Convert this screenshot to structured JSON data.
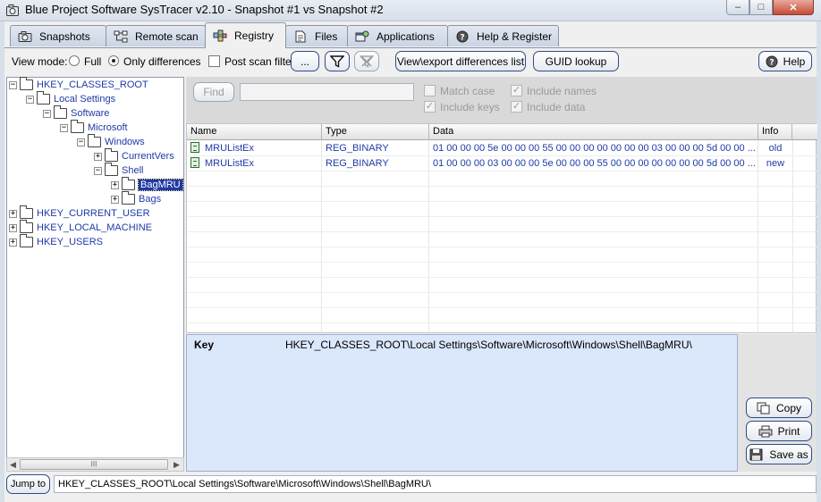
{
  "window": {
    "title": "Blue Project Software SysTracer v2.10 - Snapshot #1 vs Snapshot #2",
    "minimize": "–",
    "maximize": "□",
    "close": "✕"
  },
  "tabs": [
    {
      "label": "Snapshots",
      "icon": "camera-icon"
    },
    {
      "label": "Remote scan",
      "icon": "network-icon"
    },
    {
      "label": "Registry",
      "icon": "registry-icon",
      "active": true
    },
    {
      "label": "Files",
      "icon": "file-icon"
    },
    {
      "label": "Applications",
      "icon": "applications-icon"
    },
    {
      "label": "Help & Register",
      "icon": "help-icon"
    }
  ],
  "toolbar": {
    "view_mode_label": "View mode:",
    "full_label": "Full",
    "only_differences_label": "Only differences",
    "selected_view_mode": "Only differences",
    "post_scan_filter_label": "Post scan filter",
    "ellipsis_label": "...",
    "export_label": "View\\export differences list",
    "guid_label": "GUID lookup",
    "help_label": "Help"
  },
  "tree": {
    "items": [
      {
        "label": "HKEY_CLASSES_ROOT",
        "expander": "−"
      },
      {
        "label": "Local Settings",
        "expander": "−"
      },
      {
        "label": "Software",
        "expander": "−"
      },
      {
        "label": "Microsoft",
        "expander": "−"
      },
      {
        "label": "Windows",
        "expander": "−"
      },
      {
        "label": "CurrentVers",
        "expander": "+"
      },
      {
        "label": "Shell",
        "expander": "−"
      },
      {
        "label": "BagMRU",
        "expander": "+",
        "selected": true
      },
      {
        "label": "Bags",
        "expander": "+"
      },
      {
        "label": "HKEY_CURRENT_USER",
        "expander": "+"
      },
      {
        "label": "HKEY_LOCAL_MACHINE",
        "expander": "+"
      },
      {
        "label": "HKEY_USERS",
        "expander": "+"
      }
    ],
    "scroll_thumb": "III"
  },
  "find": {
    "button_label": "Find",
    "input_value": "",
    "match_case": "Match case",
    "include_keys": "Include keys",
    "include_names": "Include names",
    "include_data": "Include data"
  },
  "grid": {
    "columns": [
      "Name",
      "Type",
      "Data",
      "Info"
    ],
    "rows": [
      {
        "name": "MRUListEx",
        "type": "REG_BINARY",
        "data": "01 00 00 00 5e 00 00 00 55 00 00 00 00 00 00 00 03 00 00 00 5d 00 00 ...",
        "info": "old"
      },
      {
        "name": "MRUListEx",
        "type": "REG_BINARY",
        "data": "01 00 00 00 03 00 00 00 5e 00 00 00 55 00 00 00 00 00 00 00 5d 00 00 ...",
        "info": "new"
      }
    ]
  },
  "details": {
    "key_label": "Key",
    "key_path": "HKEY_CLASSES_ROOT\\Local Settings\\Software\\Microsoft\\Windows\\Shell\\BagMRU\\"
  },
  "actions": {
    "copy_label": "Copy",
    "print_label": "Print",
    "save_label": "Save as"
  },
  "statusbar": {
    "jump_label": "Jump to",
    "path": "HKEY_CLASSES_ROOT\\Local Settings\\Software\\Microsoft\\Windows\\Shell\\BagMRU\\"
  }
}
